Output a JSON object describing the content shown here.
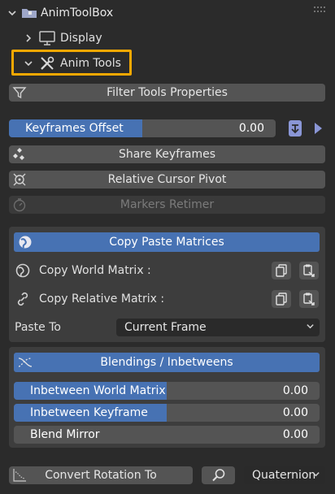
{
  "header": {
    "title": "AnimToolBox"
  },
  "tree": {
    "display_label": "Display",
    "anim_tools_label": "Anim Tools"
  },
  "tools": {
    "filter_label": "Filter Tools Properties",
    "keyframes_offset": {
      "label": "Keyframes Offset",
      "value": "0.00",
      "fill_fraction": 0.41
    },
    "share_keyframes_label": "Share Keyframes",
    "relative_cursor_pivot_label": "Relative Cursor Pivot",
    "markers_retimer_label": "Markers Retimer"
  },
  "copy_paste": {
    "title": "Copy Paste Matrices",
    "world_label": "Copy World Matrix :",
    "relative_label": "Copy Relative Matrix :",
    "paste_to_label": "Paste To",
    "paste_to_value": "Current Frame"
  },
  "blendings": {
    "title": "Blendings / Inbetweens",
    "inbetween_world": {
      "label": "Inbetween World Matrix",
      "value": "0.00",
      "fill_fraction": 0.5
    },
    "inbetween_keyframe": {
      "label": "Inbetween Keyframe",
      "value": "0.00",
      "fill_fraction": 0.5
    },
    "blend_mirror": {
      "label": "Blend Mirror",
      "value": "0.00",
      "fill_fraction": 0
    }
  },
  "footer": {
    "convert_label": "Convert Rotation To",
    "rotation_mode": "Quaternion"
  },
  "colors": {
    "accent": "#4772b3",
    "highlight": "#f5a800",
    "button": "#545454",
    "panel": "#3d3d3d",
    "background": "#2b2b2b"
  },
  "icons": [
    "chevron-down-icon",
    "folder-icon",
    "grip-icon",
    "chevron-right-icon",
    "monitor-icon",
    "tools-icon",
    "filter-icon",
    "keyframe-insert-icon",
    "play-arrow-icon",
    "share-keyframes-icon",
    "cursor-pivot-icon",
    "stopwatch-icon",
    "globe-icon",
    "copy-icon",
    "paste-icon",
    "link-icon",
    "blend-icon",
    "curve-icon",
    "search-icon"
  ]
}
